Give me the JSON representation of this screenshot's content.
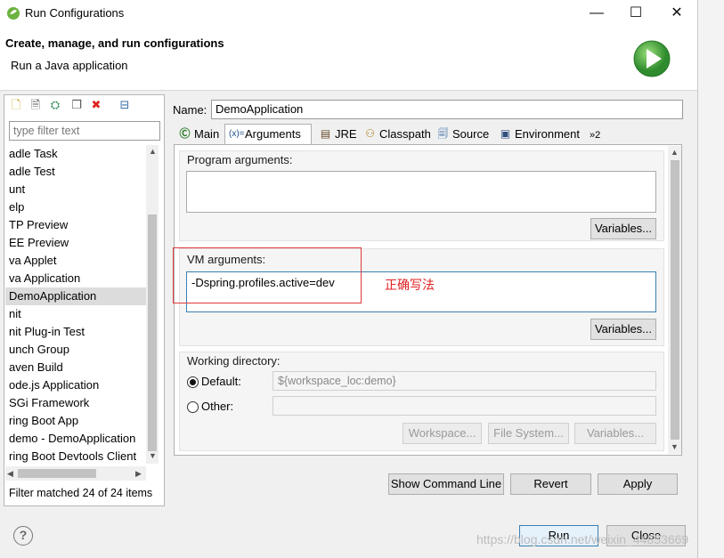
{
  "window": {
    "title": "Run Configurations",
    "minimize": "—",
    "maximize": "☐",
    "close": "✕"
  },
  "header": {
    "title": "Create, manage, and run configurations",
    "subtitle": "Run a Java application"
  },
  "left": {
    "filter_placeholder": "type filter text",
    "items": [
      "adle Task",
      "adle Test",
      "unt",
      "elp",
      "TP Preview",
      "EE Preview",
      "va Applet",
      "va Application",
      "DemoApplication",
      "nit",
      "nit Plug-in Test",
      "unch Group",
      "aven Build",
      "ode.js Application",
      "SGi Framework",
      "ring Boot App",
      "demo - DemoApplication",
      "ring Boot Devtools Client"
    ],
    "selected_index": 8,
    "status": "Filter matched 24 of 24 items"
  },
  "name": {
    "label": "Name:",
    "value": "DemoApplication"
  },
  "tabs": [
    {
      "label": "Main",
      "icon": "main-tab-icon"
    },
    {
      "label": "Arguments",
      "icon": "arguments-tab-icon"
    },
    {
      "label": "JRE",
      "icon": "jre-tab-icon"
    },
    {
      "label": "Classpath",
      "icon": "classpath-tab-icon"
    },
    {
      "label": "Source",
      "icon": "source-tab-icon"
    },
    {
      "label": "Environment",
      "icon": "environment-tab-icon"
    },
    {
      "label": "»2",
      "icon": "more-tabs-icon"
    }
  ],
  "program_args": {
    "title": "Program arguments:",
    "value": "",
    "variables_button": "Variables..."
  },
  "vm_args": {
    "title": "VM arguments:",
    "value": "-Dspring.profiles.active=dev",
    "variables_button": "Variables...",
    "annotation": "正确写法"
  },
  "working_dir": {
    "title": "Working directory:",
    "default_label": "Default:",
    "default_value": "${workspace_loc:demo}",
    "other_label": "Other:",
    "other_value": "",
    "workspace_button": "Workspace...",
    "filesystem_button": "File System...",
    "variables_button": "Variables..."
  },
  "actions": {
    "show_command_line": "Show Command Line",
    "revert": "Revert",
    "apply": "Apply",
    "run": "Run",
    "close": "Close"
  },
  "watermark": "https://blog.csdn.net/weixin_44853669",
  "colors": {
    "annotation_red": "#e03a3a",
    "run_button_border": "#3c7fb1",
    "run_icon_green": "#3aa63a"
  }
}
